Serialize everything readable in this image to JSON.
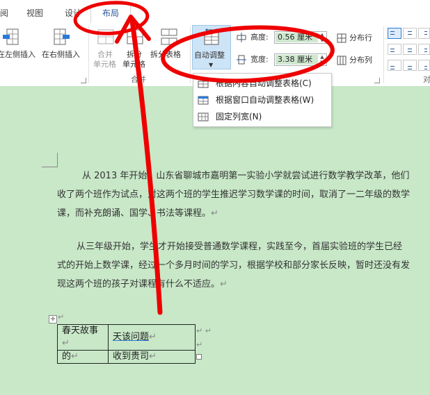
{
  "tabs": [
    {
      "label": "阅"
    },
    {
      "label": "视图"
    },
    {
      "label": "设计"
    },
    {
      "label": "布局"
    }
  ],
  "ribbon": {
    "insert_left": "在左侧插入",
    "insert_right": "在右侧插入",
    "merge_cells": [
      "合并",
      "单元格"
    ],
    "split_cells": [
      "拆分",
      "单元格"
    ],
    "split_table": "拆分表格",
    "merge_group": "合并",
    "autofit": "自动调整",
    "height_label": "高度:",
    "height_value": "0.56 厘米",
    "width_label": "宽度:",
    "width_value": "3.38 厘米",
    "distribute_rows": "分布行",
    "distribute_cols": "分布列",
    "align_group": "对"
  },
  "autofit_menu": {
    "items": [
      {
        "label": "根据内容自动调整表格(C)"
      },
      {
        "label": "根据窗口自动调整表格(W)"
      },
      {
        "label": "固定列宽(N)"
      }
    ]
  },
  "document": {
    "para1": [
      "从 2013 年开始，山东省聊城市嘉明第一实验小学就尝试进行数学教学改革，他们",
      "收了两个班作为试点，对这两个班的学生推迟学习数学课的时间，取消了一二年级的数学",
      "课，而补充朗诵、国学、书法等课程。"
    ],
    "para2": [
      "从三年级开始，学生才开始接受普通数学课程，实践至今，首届实验班的学生已经",
      "式的开始上数学课，经过一个多月时间的学习，根据学校和部分家长反映，暂时还没有发",
      "现这两个班的孩子对课程有什么不适应。"
    ],
    "table": [
      [
        "春天故事",
        "天该问题"
      ],
      [
        "的",
        "收到贵司"
      ]
    ],
    "paragraph_mark": "↵"
  },
  "colors": {
    "doc_background": "#c8e8c8",
    "accent": "#2b579a",
    "annotation": "#ee0000",
    "value_highlight": "#cfe8cf"
  }
}
